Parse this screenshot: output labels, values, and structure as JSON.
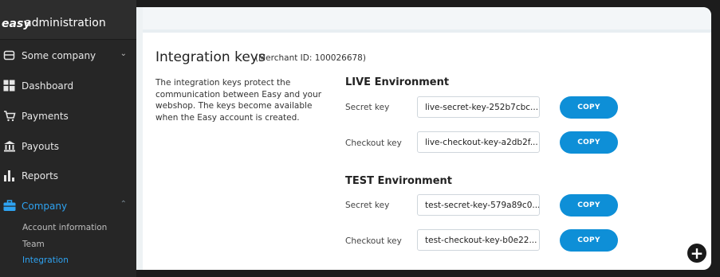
{
  "brand": {
    "logo": "easy",
    "title": "administration"
  },
  "sidebar": {
    "items": [
      {
        "label": "Some company",
        "icon": "company-switch-icon"
      },
      {
        "label": "Dashboard",
        "icon": "dashboard-icon"
      },
      {
        "label": "Payments",
        "icon": "cart-icon"
      },
      {
        "label": "Payouts",
        "icon": "bank-icon"
      },
      {
        "label": "Reports",
        "icon": "bar-chart-icon"
      },
      {
        "label": "Company",
        "icon": "briefcase-icon",
        "active": true
      }
    ],
    "subitems": [
      {
        "label": "Account information"
      },
      {
        "label": "Team"
      },
      {
        "label": "Integration",
        "active": true
      }
    ],
    "active_color": "#2ea3f2"
  },
  "main": {
    "title": "Integration keys",
    "merchant": "(Merchant ID: 100026678)",
    "description": "The integration keys protect the communication between Easy and your webshop. The keys become available when the Easy account is created.",
    "live": {
      "heading": "LIVE Environment",
      "secret_label": "Secret key",
      "secret_value": "live-secret-key-252b7cbc...",
      "checkout_label": "Checkout key",
      "checkout_value": "live-checkout-key-a2db2f..."
    },
    "test": {
      "heading": "TEST Environment",
      "secret_label": "Secret key",
      "secret_value": "test-secret-key-579a89c0...",
      "checkout_label": "Checkout key",
      "checkout_value": "test-checkout-key-b0e22..."
    },
    "copy_label": "COPY",
    "fab_label": "+",
    "button_color": "#0e8fd7"
  }
}
